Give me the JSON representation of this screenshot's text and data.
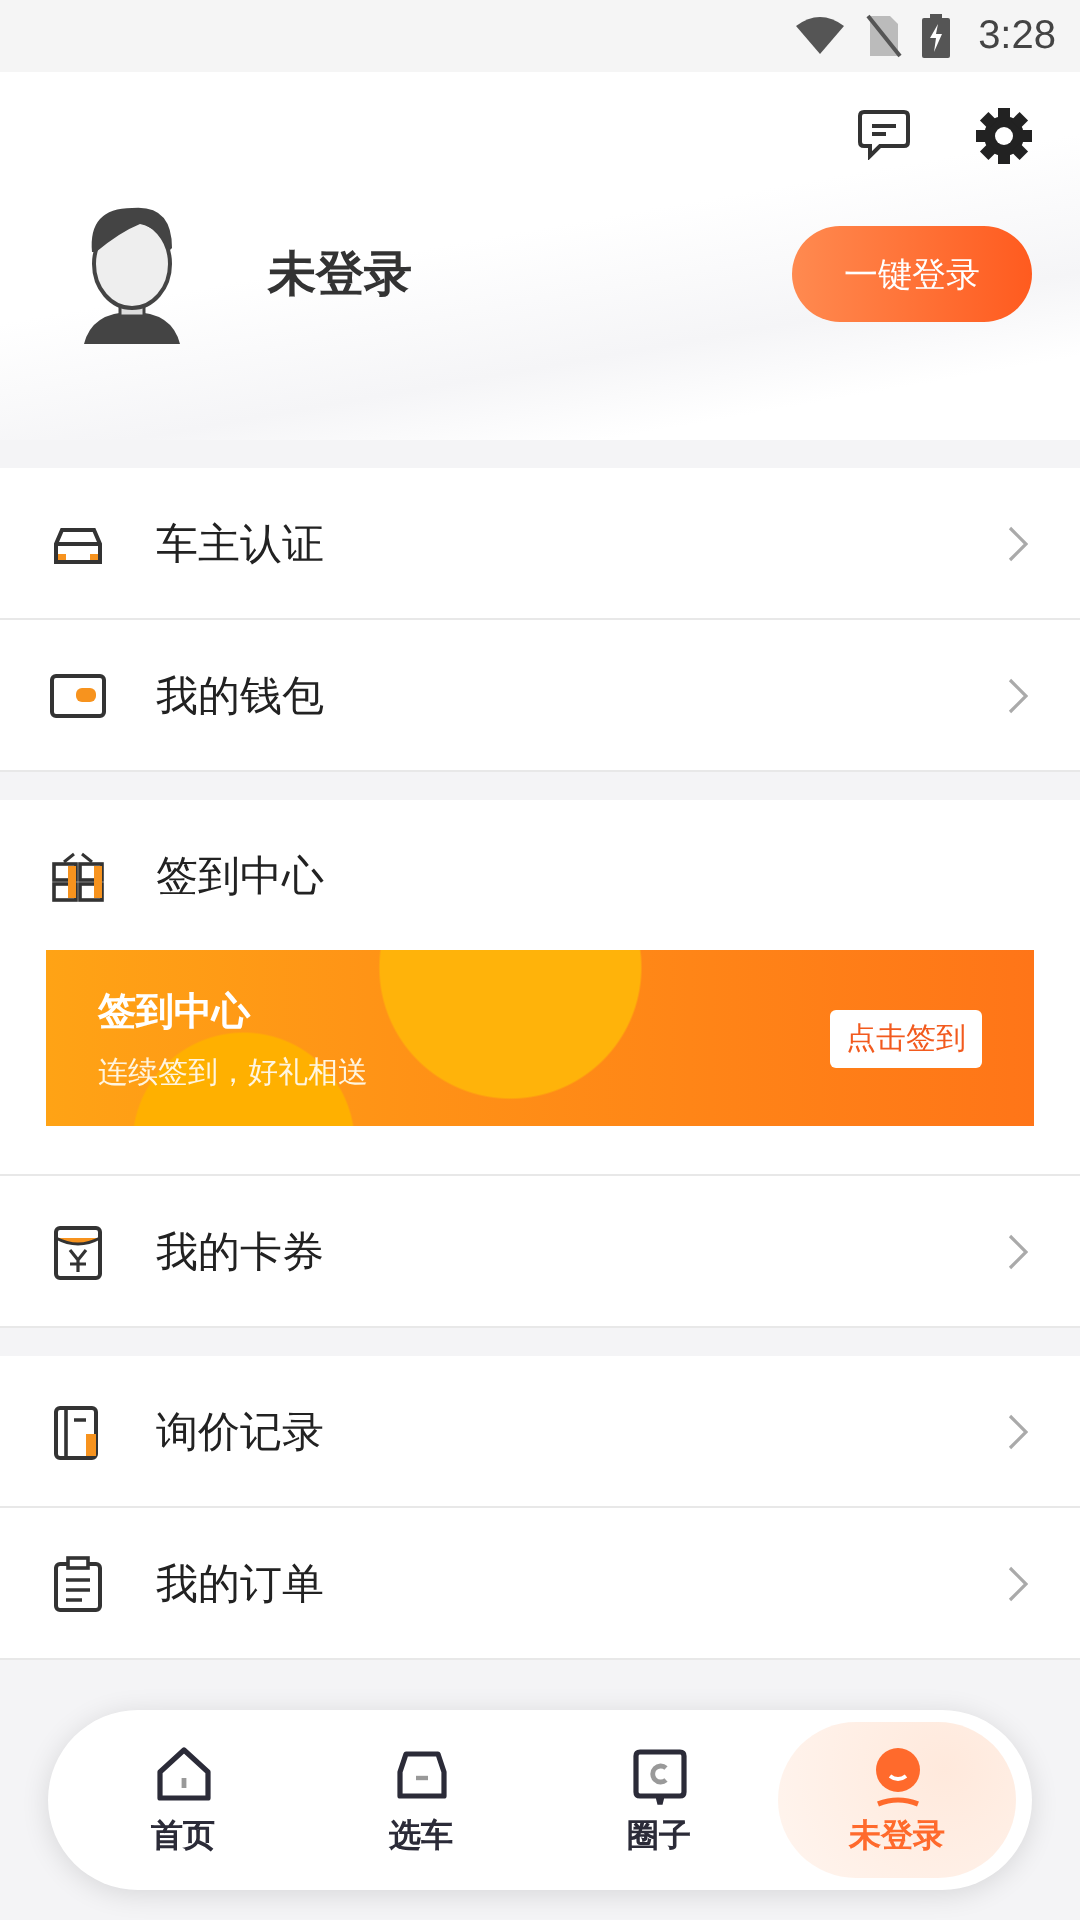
{
  "status_bar": {
    "time": "3:28"
  },
  "profile": {
    "name": "未登录",
    "login_button": "一键登录"
  },
  "groups": [
    {
      "items": [
        {
          "kind": "link",
          "label": "车主认证"
        },
        {
          "kind": "link",
          "label": "我的钱包"
        }
      ]
    },
    {
      "items": [
        {
          "kind": "header",
          "label": "签到中心"
        },
        {
          "kind": "banner",
          "title": "签到中心",
          "subtitle": "连续签到，好礼相送",
          "button": "点击签到"
        },
        {
          "kind": "link",
          "label": "我的卡券"
        }
      ]
    },
    {
      "items": [
        {
          "kind": "link",
          "label": "询价记录"
        },
        {
          "kind": "link",
          "label": "我的订单"
        }
      ]
    }
  ],
  "tab_bar": [
    {
      "label": "首页",
      "selected": false
    },
    {
      "label": "选车",
      "selected": false
    },
    {
      "label": "圈子",
      "selected": false
    },
    {
      "label": "未登录",
      "selected": true
    }
  ]
}
